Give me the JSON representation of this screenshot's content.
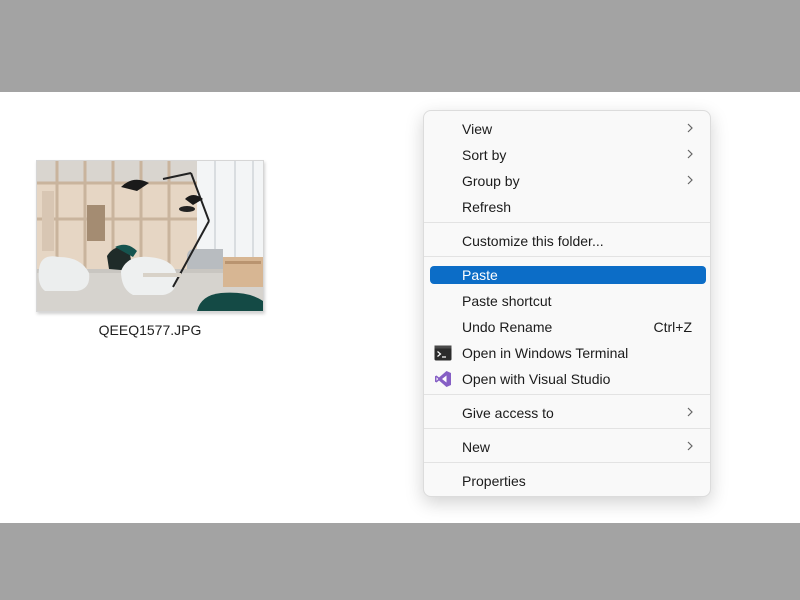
{
  "file": {
    "name": "QEEQ1577.JPG"
  },
  "menu": {
    "items": [
      {
        "label": "View",
        "submenu": true
      },
      {
        "label": "Sort by",
        "submenu": true
      },
      {
        "label": "Group by",
        "submenu": true
      },
      {
        "label": "Refresh"
      },
      {
        "label": "Customize this folder..."
      },
      {
        "label": "Paste",
        "highlighted": true
      },
      {
        "label": "Paste shortcut"
      },
      {
        "label": "Undo Rename",
        "shortcut": "Ctrl+Z"
      },
      {
        "label": "Open in Windows Terminal",
        "icon": "terminal-icon"
      },
      {
        "label": "Open with Visual Studio",
        "icon": "visual-studio-icon"
      },
      {
        "label": "Give access to",
        "submenu": true
      },
      {
        "label": "New",
        "submenu": true
      },
      {
        "label": "Properties"
      }
    ]
  },
  "colors": {
    "highlight": "#0c6dc7",
    "outer_background": "#a3a3a3",
    "desktop_background": "#ffffff",
    "visual_studio_purple": "#865fc5"
  }
}
